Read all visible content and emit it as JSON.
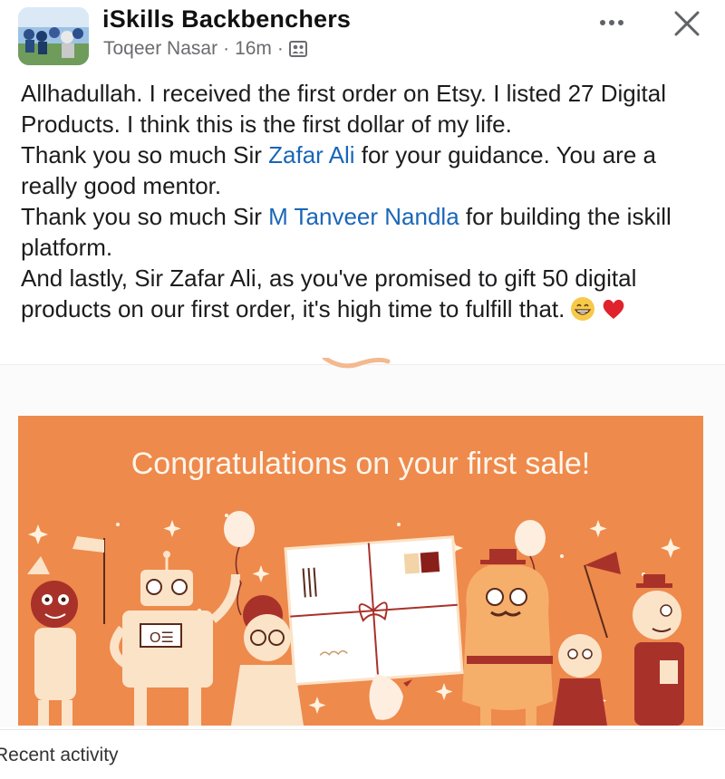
{
  "header": {
    "group_name": "iSkills Backbenchers",
    "author": "Toqeer Nasar",
    "time": "16m",
    "separator": "·",
    "privacy_icon": "members-icon",
    "more_icon": "more-icon",
    "close_icon": "close-icon"
  },
  "post": {
    "p1": "Allhadullah. I received the first order on Etsy. I listed 27 Digital Products. I think this is the first dollar of my life.",
    "p2_before": "Thank you so much Sir ",
    "p2_mention": "Zafar Ali",
    "p2_after": "  for your guidance. You are a really good mentor.",
    "p3_before": "Thank you so much Sir ",
    "p3_mention": "M Tanveer Nandla",
    "p3_after": " for building the iskill platform.",
    "p4": "And lastly, Sir Zafar Ali, as you've promised to gift 50 digital products on our first order, it's high time to fulfill that.",
    "emojis": [
      "grinning-face-emoji",
      "red-heart-emoji"
    ]
  },
  "image": {
    "title": "Congratulations on your first sale!",
    "background_color": "#ee8a4c"
  },
  "footer": {
    "recent_activity": "Recent activity"
  },
  "colors": {
    "mention": "#1a66b8",
    "text": "#1c1c1e",
    "meta": "#6b6b70"
  }
}
